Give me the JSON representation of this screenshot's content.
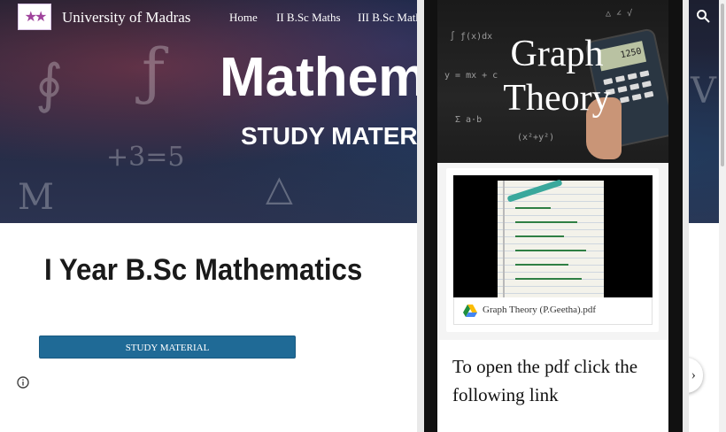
{
  "site": {
    "name": "University of Madras",
    "nav": [
      "Home",
      "II B.Sc Maths",
      "III B.Sc Math"
    ],
    "hero_title": "Mathem",
    "hero_subtitle": "STUDY MATER",
    "section_heading": "I Year B.Sc Mathematics",
    "study_button": "STUDY MATERIAL",
    "icons": {
      "search": "search-icon",
      "info": "info-icon",
      "logo": "university-logo"
    }
  },
  "overlay": {
    "banner_title_line1": "Graph",
    "banner_title_line2": "Theory",
    "calculator_display": "1250",
    "file_name": "Graph Theory (P.Geetha).pdf",
    "open_text": "To open the pdf click the following link",
    "icons": {
      "drive": "google-drive-icon"
    }
  },
  "colors": {
    "button": "#1f6a96",
    "heading": "#1a1a1a",
    "overlay_frame": "#111111"
  }
}
